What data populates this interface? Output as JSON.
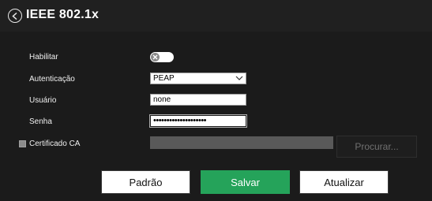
{
  "header": {
    "title": "IEEE 802.1x"
  },
  "form": {
    "enable": {
      "label": "Habilitar",
      "state": "off"
    },
    "authentication": {
      "label": "Autenticação",
      "value": "PEAP"
    },
    "user": {
      "label": "Usuário",
      "value": "none"
    },
    "password": {
      "label": "Senha",
      "value": "••••••••••••••••••••"
    },
    "ca_certificate": {
      "label": "Certificado CA",
      "checked": false,
      "browse_label": "Procurar..."
    }
  },
  "buttons": {
    "default_label": "Padrão",
    "save_label": "Salvar",
    "refresh_label": "Atualizar"
  },
  "colors": {
    "background": "#1b1b1b",
    "save_button": "#25a35a",
    "file_bar": "#595959"
  }
}
